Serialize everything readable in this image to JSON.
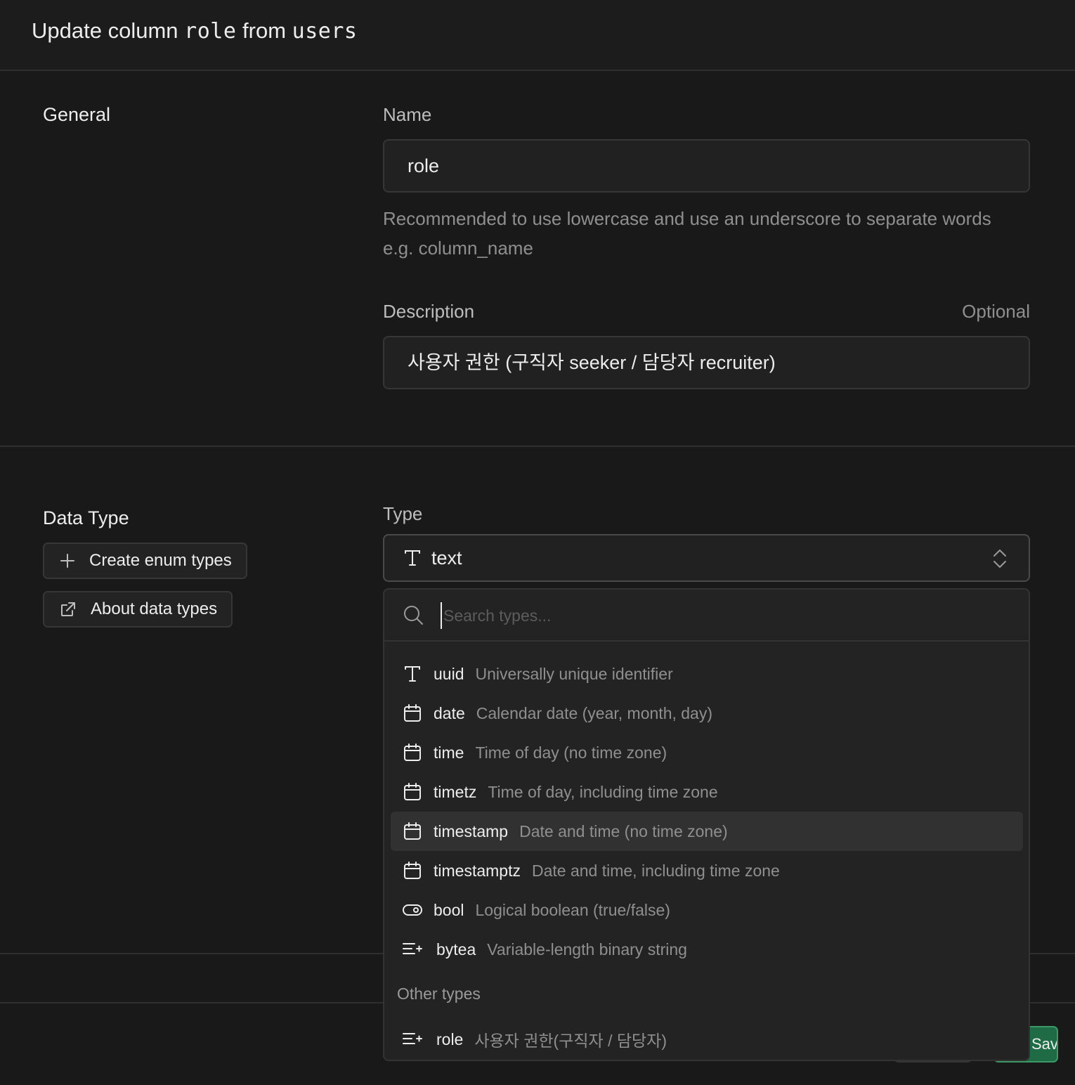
{
  "header": {
    "prefix": "Update column",
    "column": "role",
    "middle": "from",
    "table": "users"
  },
  "general": {
    "section_label": "General",
    "name_label": "Name",
    "name_value": "role",
    "name_hint": "Recommended to use lowercase and use an underscore to separate words e.g. column_name",
    "description_label": "Description",
    "description_optional": "Optional",
    "description_value": "사용자 권한 (구직자 seeker / 담당자 recruiter)"
  },
  "data_type": {
    "section_label": "Data Type",
    "create_enum_label": "Create enum types",
    "about_label": "About data types",
    "type_label": "Type",
    "selected_type": "text",
    "search_placeholder": "Search types...",
    "options": [
      {
        "name": "uuid",
        "desc": "Universally unique identifier",
        "icon": "text-type-icon"
      },
      {
        "name": "date",
        "desc": "Calendar date (year, month, day)",
        "icon": "calendar-icon"
      },
      {
        "name": "time",
        "desc": "Time of day (no time zone)",
        "icon": "calendar-icon"
      },
      {
        "name": "timetz",
        "desc": "Time of day, including time zone",
        "icon": "calendar-icon"
      },
      {
        "name": "timestamp",
        "desc": "Date and time (no time zone)",
        "icon": "calendar-icon"
      },
      {
        "name": "timestamptz",
        "desc": "Date and time, including time zone",
        "icon": "calendar-icon"
      },
      {
        "name": "bool",
        "desc": "Logical boolean (true/false)",
        "icon": "toggle-icon"
      },
      {
        "name": "bytea",
        "desc": "Variable-length binary string",
        "icon": "list-plus-icon"
      }
    ],
    "other_group_label": "Other types",
    "other_options": [
      {
        "name": "role",
        "desc": "사용자 권한(구직자 / 담당자)",
        "icon": "list-plus-icon"
      }
    ]
  },
  "footer": {
    "save_label": "Save"
  }
}
